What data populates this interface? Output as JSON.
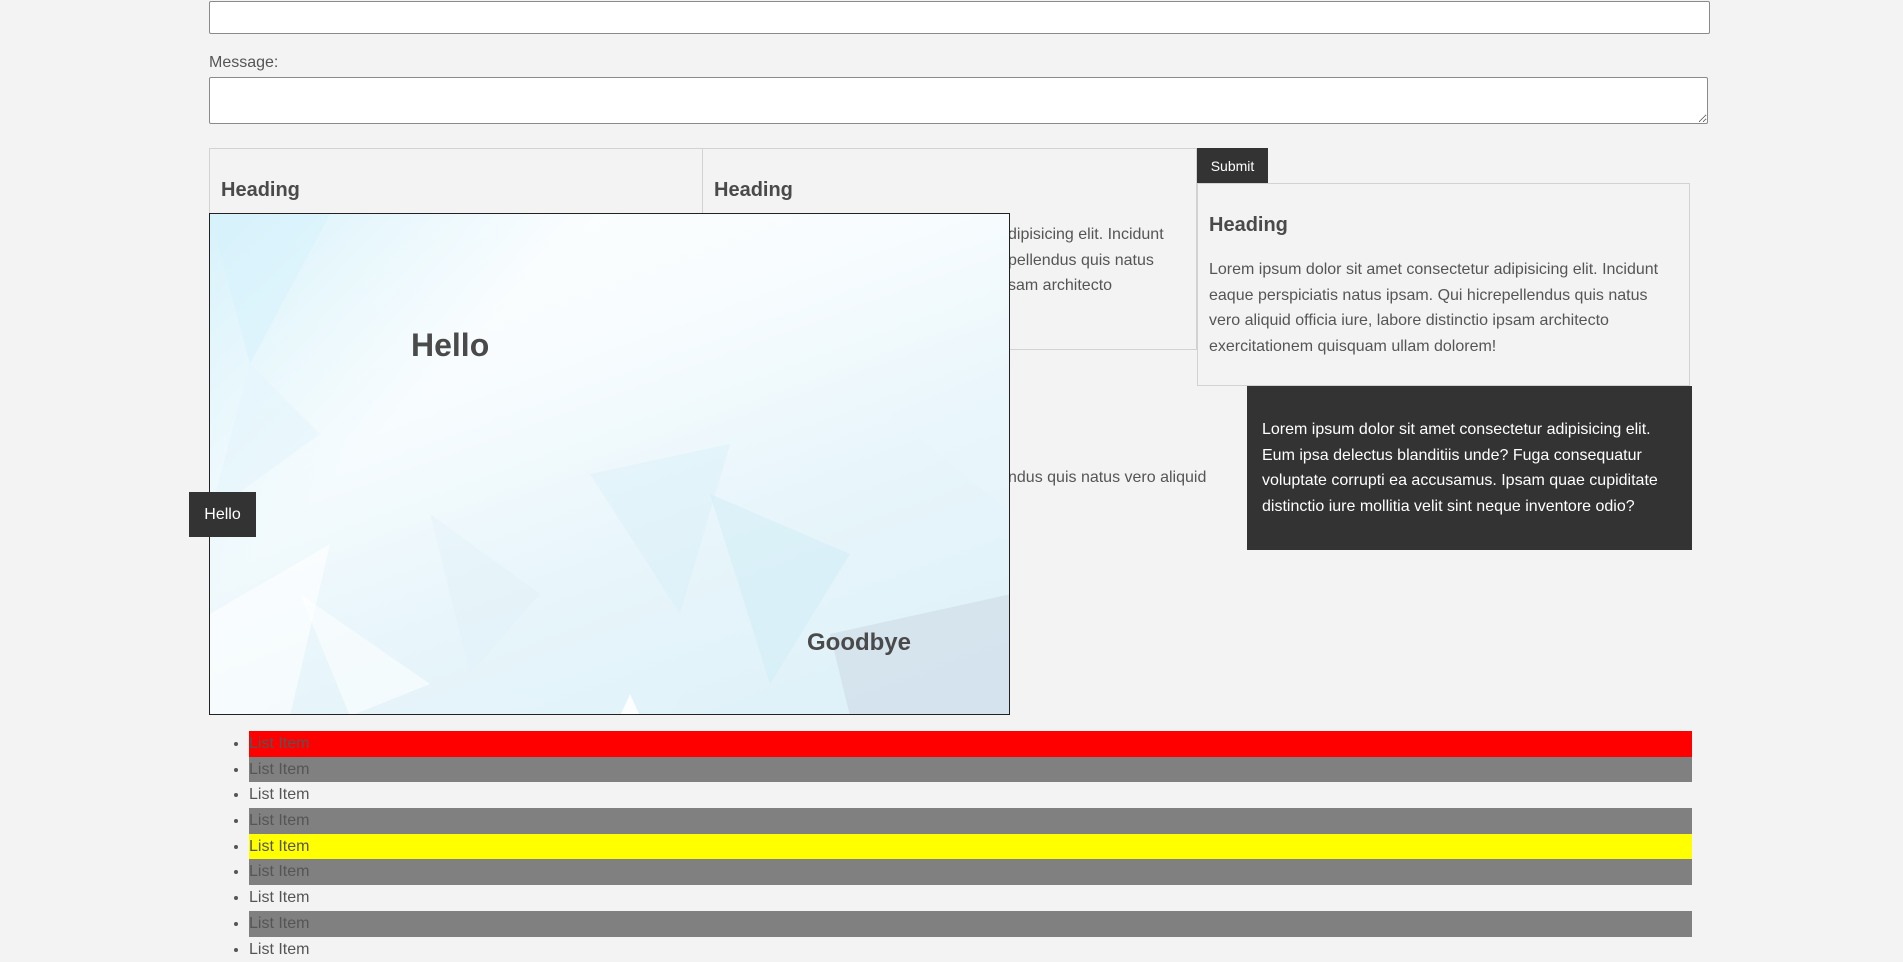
{
  "form": {
    "message_label": "Message:",
    "submit_label": "Submit"
  },
  "cards": [
    {
      "heading": "Heading"
    },
    {
      "heading": "Heading",
      "text_lines": [
        "dipisicing elit. Incidunt",
        "pellendus quis natus",
        "sam architecto"
      ]
    },
    {
      "heading": "Heading",
      "text": "Lorem ipsum dolor sit amet consectetur adipisicing elit. Incidunt eaque perspiciatis natus ipsam. Qui hicrepellendus quis natus vero aliquid officia iure, labore distinctio ipsam architecto exercitationem quisquam ullam dolorem!"
    }
  ],
  "stray_text": "ndus quis natus vero aliquid",
  "dark_box": {
    "text": "Lorem ipsum dolor sit amet consectetur adipisicing elit. Eum ipsa delectus blanditiis unde? Fuga consequatur voluptate corrupti ea accusamus. Ipsam quae cupiditate distinctio iure mollitia velit sint neque inventore odio?"
  },
  "hero": {
    "hello": "Hello",
    "goodbye": "Goodbye"
  },
  "hello_tab": "Hello",
  "list": {
    "items": [
      {
        "label": "List Item",
        "color": "#ff0000"
      },
      {
        "label": "List Item",
        "color": "#808080"
      },
      {
        "label": "List Item",
        "color": "none"
      },
      {
        "label": "List Item",
        "color": "#808080"
      },
      {
        "label": "List Item",
        "color": "#ffff00"
      },
      {
        "label": "List Item",
        "color": "#808080"
      },
      {
        "label": "List Item",
        "color": "none"
      },
      {
        "label": "List Item",
        "color": "#808080"
      },
      {
        "label": "List Item",
        "color": "none"
      }
    ]
  }
}
